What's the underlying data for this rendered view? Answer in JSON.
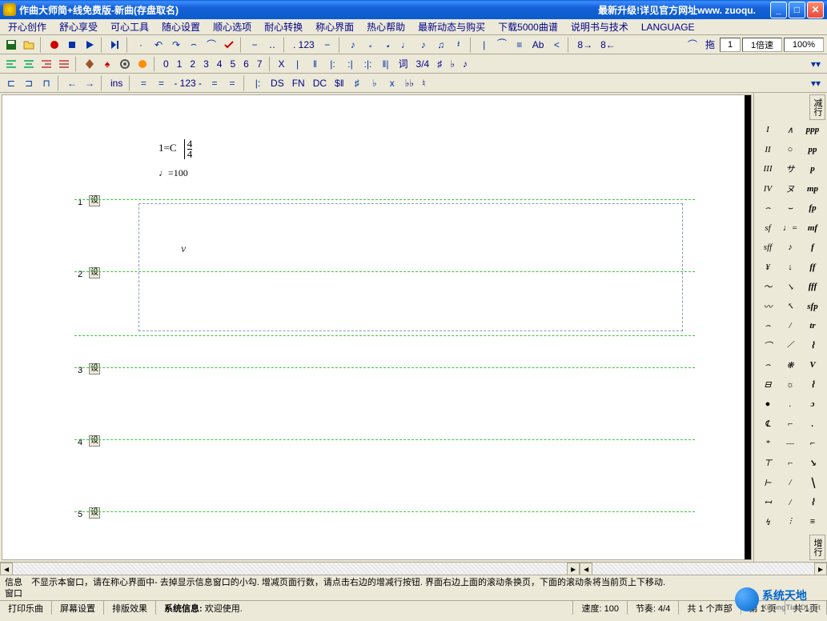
{
  "window": {
    "title": "作曲大师简+线免费版-新曲(存盘取名)",
    "promo": "最新升级!详见官方网址www. zuoqu."
  },
  "menu": {
    "items": [
      "开心创作",
      "舒心享受",
      "可心工具",
      "随心设置",
      "顺心选项",
      "耐心转换",
      "称心界面",
      "热心帮助",
      "最新动态与购买",
      "下载5000曲谱",
      "说明书与技术",
      "LANGUAGE"
    ]
  },
  "toolbar1": {
    "page_label": ". 123",
    "ab_label": "Ab",
    "eight_plus": "8→",
    "eight_minus": "8←",
    "drag_label": "拖",
    "drag_value": "1",
    "speed_label": "1倍速",
    "zoom": "100%"
  },
  "toolbar2": {
    "numbers": [
      "0",
      "1",
      "2",
      "3",
      "4",
      "5",
      "6",
      "7"
    ],
    "x_label": "X",
    "ci_label": "词",
    "ts_label": "3/4",
    "sharp": "♯",
    "flat": "♭",
    "note": "♪"
  },
  "toolbar3": {
    "ins_label": "ins",
    "dash123": "- 123 -",
    "ds_label": "DS",
    "fn_label": "FN",
    "dc_label": "DC",
    "seg": "$‖",
    "dflat": "♭♭",
    "nat": "♮"
  },
  "notation": {
    "key": "1=C",
    "ts_num": "4",
    "ts_den": "4",
    "tempo_symbol": "♩",
    "tempo_value": "=100",
    "v_mark": "v",
    "staff_label": "设",
    "staff_count": 5
  },
  "right_panel": {
    "top_label": "减行",
    "bottom_label": "增行",
    "symbols": [
      [
        "I",
        "∧",
        "ppp"
      ],
      [
        "II",
        "○",
        "pp"
      ],
      [
        "III",
        "サ",
        "p"
      ],
      [
        "IV",
        "ヌ",
        "mp"
      ],
      [
        "⌢",
        "⌣",
        "fp"
      ],
      [
        "sf",
        "♩=",
        "mf"
      ],
      [
        "sff",
        "♪",
        "f"
      ],
      [
        "¥",
        "↓",
        "ff"
      ],
      [
        "〜",
        "↘",
        "fff"
      ],
      [
        "〰",
        "↖",
        "sfp"
      ],
      [
        "⌢",
        "/",
        "tr"
      ],
      [
        "⌒",
        "⟋",
        "⌇"
      ],
      [
        "⌢",
        "❋",
        "V"
      ],
      [
        "⊟",
        "☼",
        "⌇"
      ],
      [
        "●",
        ".",
        "ɔ"
      ],
      [
        "℄",
        "⌐",
        "."
      ],
      [
        "*",
        "—",
        "⌐"
      ],
      [
        "⊤",
        "⌐",
        "↘"
      ],
      [
        "⊢",
        "/",
        "╲"
      ],
      [
        "↤",
        "/",
        "⌇"
      ],
      [
        "↯",
        "⫶",
        "≡"
      ]
    ]
  },
  "info": {
    "label": "信息窗口",
    "text": "不显示本窗口，请在称心界面中- 去掉显示信息窗口的小勾. 增减页面行数，请点击右边的增减行按钮. 界面右边上面的滚动条换页，下面的滚动条将当前页上下移动."
  },
  "status": {
    "items": [
      "打印乐曲",
      "屏幕设置",
      "排版效果"
    ],
    "sysinfo_label": "系统信息:",
    "sysinfo_text": "欢迎使用.",
    "speed": "速度: 100",
    "beat": "节奏: 4/4",
    "voices": "共 1 个声部",
    "page": "第 1 页",
    "total_pages": "共 1页"
  },
  "watermark": {
    "cn": "系统天地",
    "en": "XiTongTianDi.net"
  }
}
